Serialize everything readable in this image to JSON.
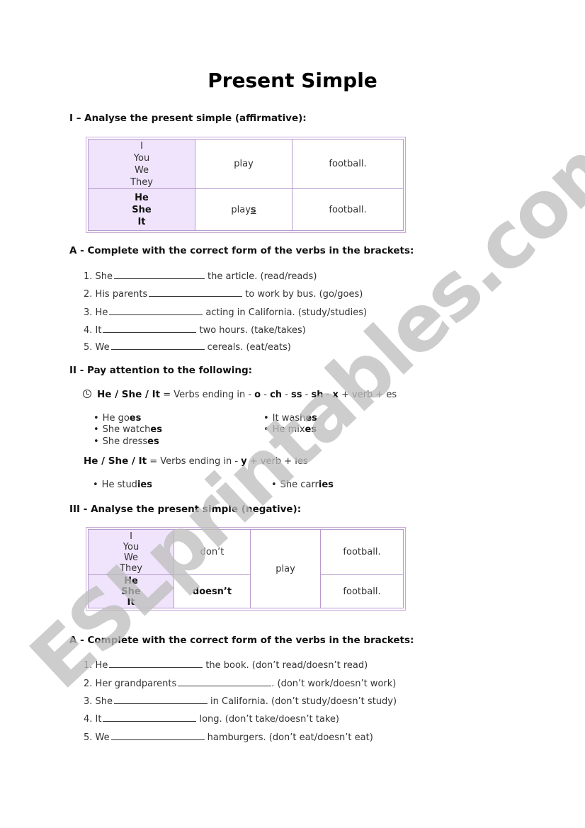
{
  "title": "Present Simple",
  "watermark": "ESLprintables.com",
  "section1": {
    "heading": "I – Analyse the present simple (affirmative):",
    "table": {
      "row1": {
        "subjects": [
          "I",
          "You",
          "We",
          "They"
        ],
        "verb": "play",
        "object": "football."
      },
      "row2": {
        "subjects": [
          "He",
          "She",
          "It"
        ],
        "verb_base": "play",
        "verb_suffix": "s",
        "object": "football."
      }
    }
  },
  "exerciseA1": {
    "heading": "A - Complete with the correct form of the verbs in the brackets:",
    "items": [
      {
        "num": "1.",
        "before": "She",
        "after": "the article. (read/reads)"
      },
      {
        "num": "2.",
        "before": "His parents",
        "after": "to work by bus. (go/goes)"
      },
      {
        "num": "3.",
        "before": "He",
        "after": "acting in California. (study/studies)"
      },
      {
        "num": "4.",
        "before": "It",
        "after": "two hours. (take/takes)"
      },
      {
        "num": "5.",
        "before": "We",
        "after": "cereals. (eat/eats)"
      }
    ]
  },
  "section2": {
    "heading": "II - Pay attention to the following:",
    "rule1": {
      "icon": "clock-icon",
      "subject": "He / She / It",
      "eq": " = Verbs ending in - ",
      "endings": [
        "o",
        "ch",
        "ss",
        "sh",
        "x"
      ],
      "tail": " + verb + es"
    },
    "examples1_left": [
      {
        "base": "He go",
        "suffix": "es"
      },
      {
        "base": "She watch",
        "suffix": "es"
      },
      {
        "base": "She dress",
        "suffix": "es"
      }
    ],
    "examples1_right": [
      {
        "base": "It wash",
        "suffix": "es"
      },
      {
        "base": "He mix",
        "suffix": "es"
      }
    ],
    "rule2": {
      "subject": "He / She / It",
      "eq": " = Verbs ending in - ",
      "ending": "y",
      "tail": " + verb + ies"
    },
    "examples2": [
      {
        "base": "He stud",
        "suffix": "ies"
      },
      {
        "base": "She carr",
        "suffix": "ies"
      }
    ]
  },
  "section3": {
    "heading": "III - Analyse the present simple (negative):",
    "table": {
      "row1": {
        "subjects": [
          "I",
          "You",
          "We",
          "They"
        ],
        "aux": "don’t",
        "object": "football."
      },
      "row2": {
        "subjects": [
          "He",
          "She",
          "It"
        ],
        "aux": "doesn’t",
        "object": "football."
      },
      "verb": "play"
    }
  },
  "exerciseA2": {
    "heading": "A - Complete with the correct form of the verbs in the brackets:",
    "items": [
      {
        "num": "1.",
        "before": "He",
        "after": "the book. (don’t read/doesn’t read)"
      },
      {
        "num": "2.",
        "before": "Her grandparents",
        "after": ". (don’t work/doesn’t work)"
      },
      {
        "num": "3.",
        "before": "She",
        "after": "in California. (don’t study/doesn’t study)"
      },
      {
        "num": "4.",
        "before": "It",
        "after": "long. (don’t take/doesn’t take)"
      },
      {
        "num": "5.",
        "before": "We",
        "after": "hamburgers. (don’t eat/doesn’t eat)"
      }
    ]
  },
  "colors": {
    "table_border": "#b89acc",
    "table_shade": "#efe4fb",
    "watermark": "#bdbdbd"
  }
}
